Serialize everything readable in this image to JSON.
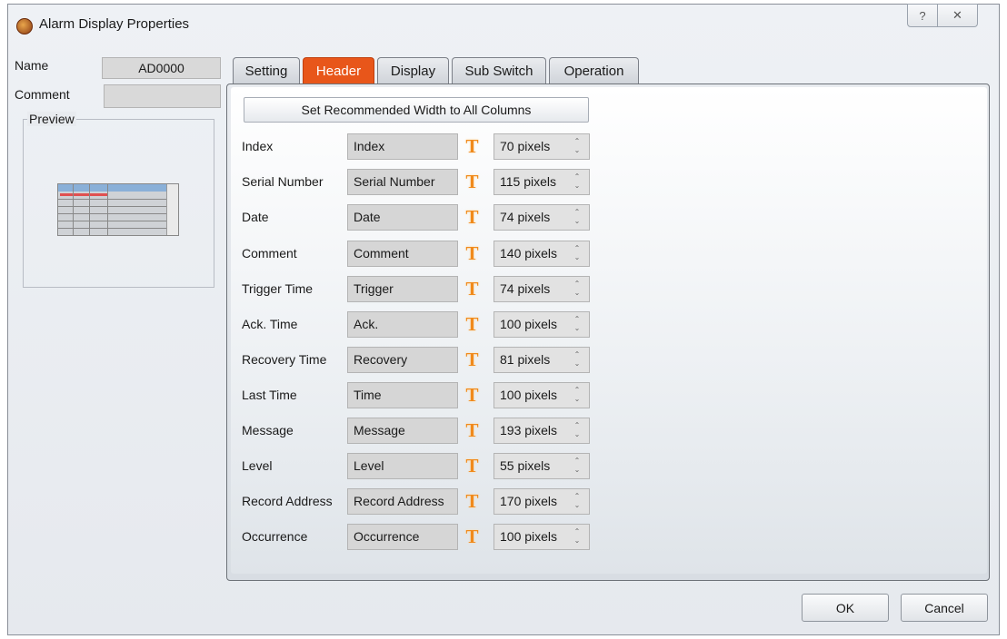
{
  "window": {
    "title": "Alarm Display Properties",
    "help_glyph": "?",
    "close_glyph": "✕"
  },
  "left": {
    "name_label": "Name",
    "name_value": "AD0000",
    "comment_label": "Comment",
    "comment_value": "",
    "preview_label": "Preview"
  },
  "tabs": [
    {
      "label": "Setting"
    },
    {
      "label": "Header",
      "active": true
    },
    {
      "label": "Display"
    },
    {
      "label": "Sub Switch"
    },
    {
      "label": "Operation"
    }
  ],
  "header_tab": {
    "recommend_button": "Set Recommended Width to All Columns",
    "rows": [
      {
        "label": "Index",
        "name": "Index",
        "width": "70 pixels"
      },
      {
        "label": "Serial Number",
        "name": "Serial Number",
        "width": "115 pixels"
      },
      {
        "label": "Date",
        "name": "Date",
        "width": "74 pixels"
      },
      {
        "label": "Comment",
        "name": "Comment",
        "width": "140 pixels"
      },
      {
        "label": "Trigger Time",
        "name": "Trigger",
        "width": "74 pixels"
      },
      {
        "label": "Ack. Time",
        "name": "Ack.",
        "width": "100 pixels"
      },
      {
        "label": "Recovery Time",
        "name": "Recovery",
        "width": "81 pixels"
      },
      {
        "label": "Last Time",
        "name": "Time",
        "width": "100 pixels"
      },
      {
        "label": "Message",
        "name": "Message",
        "width": "193 pixels"
      },
      {
        "label": "Level",
        "name": "Level",
        "width": "55 pixels"
      },
      {
        "label": "Record Address",
        "name": "Record Address",
        "width": "170 pixels"
      },
      {
        "label": "Occurrence",
        "name": "Occurrence",
        "width": "100 pixels"
      }
    ],
    "font_icon_glyph": "T",
    "spin_glyph": "⌃⌄"
  },
  "footer": {
    "ok": "OK",
    "cancel": "Cancel"
  },
  "colors": {
    "active_tab": "#e8561a",
    "font_icon": "#f08a1c"
  }
}
